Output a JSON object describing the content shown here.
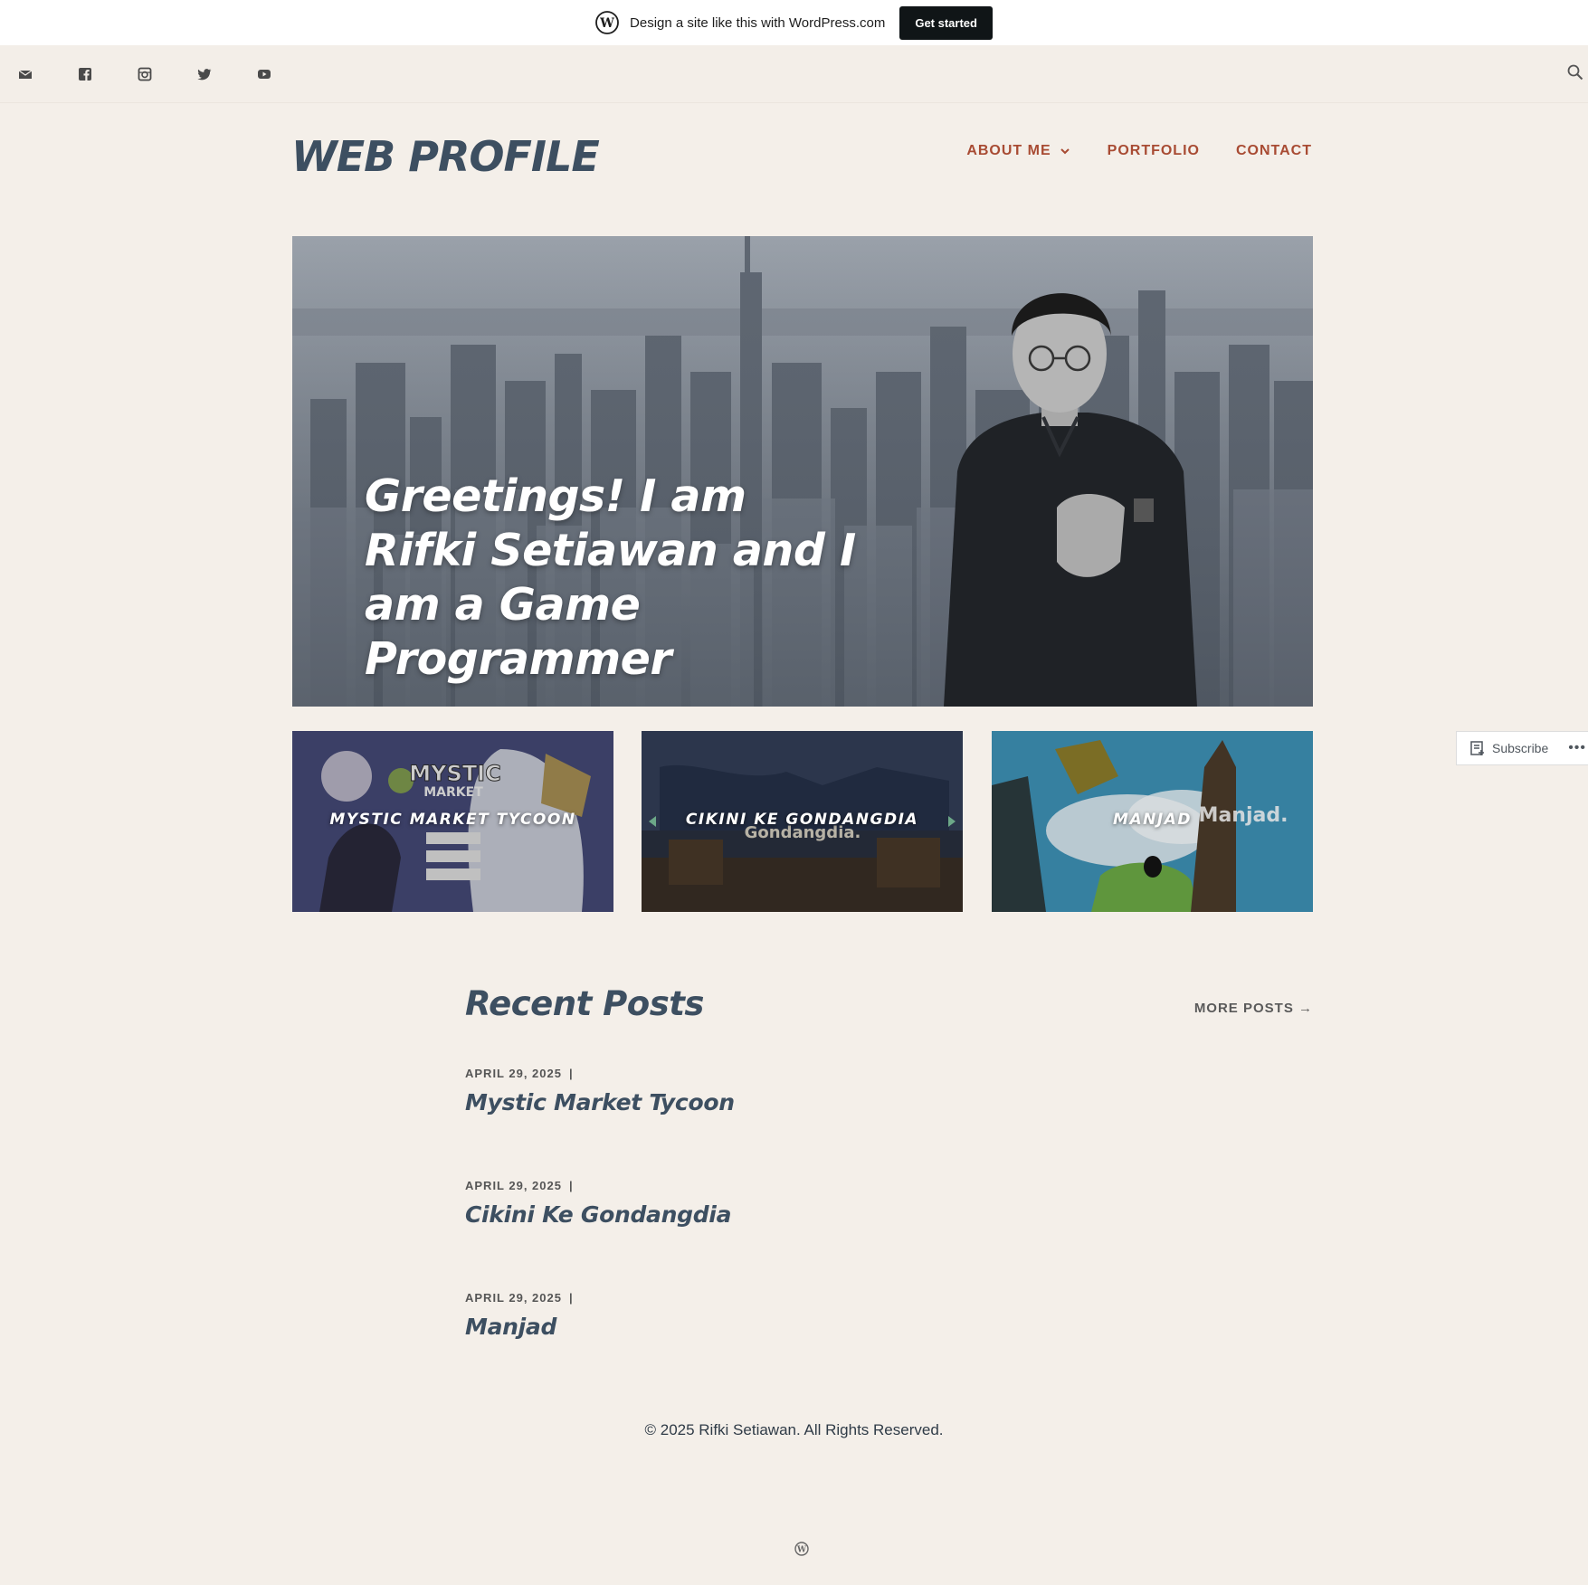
{
  "wp_banner": {
    "text": "Design a site like this with WordPress.com",
    "button": "Get started"
  },
  "social": {
    "icons": [
      "mail-icon",
      "facebook-icon",
      "instagram-icon",
      "twitter-icon",
      "youtube-icon"
    ],
    "search_icon": "search-icon"
  },
  "header": {
    "site_title": "WEB PROFILE",
    "nav": [
      {
        "label": "ABOUT ME",
        "has_dropdown": true
      },
      {
        "label": "PORTFOLIO"
      },
      {
        "label": "CONTACT"
      }
    ]
  },
  "hero": {
    "title": "Greetings! I am Rifki Setiawan and I am a Game Programmer"
  },
  "portfolio": {
    "tiles": [
      {
        "label": "MYSTIC MARKET TYCOON"
      },
      {
        "label": "CIKINI KE GONDANGDIA"
      },
      {
        "label": "MANJAD"
      }
    ]
  },
  "subscribe": {
    "label": "Subscribe",
    "more": "•••"
  },
  "recent_posts": {
    "title": "Recent Posts",
    "more_link": "MORE POSTS →",
    "posts": [
      {
        "date": "APRIL 29, 2025",
        "title": "Mystic Market Tycoon"
      },
      {
        "date": "APRIL 29, 2025",
        "title": "Cikini Ke Gondangdia"
      },
      {
        "date": "APRIL 29, 2025",
        "title": "Manjad"
      }
    ]
  },
  "footer": {
    "copyright": "© 2025 Rifki Setiawan. All Rights Reserved."
  },
  "colors": {
    "background": "#f4efe9",
    "title": "#3d4f61",
    "nav_accent": "#a84b33"
  }
}
